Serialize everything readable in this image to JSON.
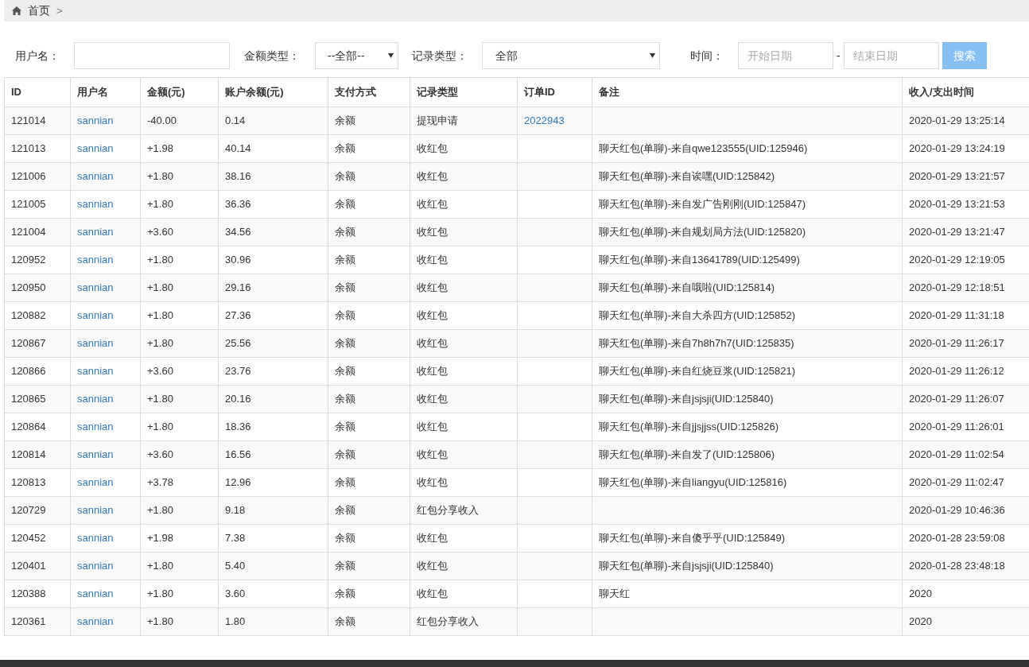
{
  "breadcrumb": {
    "home": "首页",
    "separator": ">"
  },
  "filters": {
    "username_label": "用户名：",
    "amount_type_label": "金额类型：",
    "amount_type_value": "--全部--",
    "record_type_label": "记录类型：",
    "record_type_value": "全部",
    "time_label": "时间：",
    "start_placeholder": "开始日期",
    "range_separator": "-",
    "end_placeholder": "结束日期",
    "search_button": "搜索"
  },
  "table": {
    "columns": [
      "ID",
      "用户名",
      "金额(元)",
      "账户余额(元)",
      "支付方式",
      "记录类型",
      "订单ID",
      "备注",
      "收入/支出时间"
    ],
    "rows": [
      [
        "121014",
        "sannian",
        "-40.00",
        "0.14",
        "余额",
        "提现申请",
        "2022943",
        "",
        "2020-01-29 13:25:14"
      ],
      [
        "121013",
        "sannian",
        "+1.98",
        "40.14",
        "余额",
        "收红包",
        "",
        "聊天红包(单聊)-来自qwe123555(UID:125946)",
        "2020-01-29 13:24:19"
      ],
      [
        "121006",
        "sannian",
        "+1.80",
        "38.16",
        "余额",
        "收红包",
        "",
        "聊天红包(单聊)-来自诶嘿(UID:125842)",
        "2020-01-29 13:21:57"
      ],
      [
        "121005",
        "sannian",
        "+1.80",
        "36.36",
        "余额",
        "收红包",
        "",
        "聊天红包(单聊)-来自发广告刚刚(UID:125847)",
        "2020-01-29 13:21:53"
      ],
      [
        "121004",
        "sannian",
        "+3.60",
        "34.56",
        "余额",
        "收红包",
        "",
        "聊天红包(单聊)-来自规划局方法(UID:125820)",
        "2020-01-29 13:21:47"
      ],
      [
        "120952",
        "sannian",
        "+1.80",
        "30.96",
        "余额",
        "收红包",
        "",
        "聊天红包(单聊)-来自13641789(UID:125499)",
        "2020-01-29 12:19:05"
      ],
      [
        "120950",
        "sannian",
        "+1.80",
        "29.16",
        "余额",
        "收红包",
        "",
        "聊天红包(单聊)-来自哦啦(UID:125814)",
        "2020-01-29 12:18:51"
      ],
      [
        "120882",
        "sannian",
        "+1.80",
        "27.36",
        "余额",
        "收红包",
        "",
        "聊天红包(单聊)-来自大杀四方(UID:125852)",
        "2020-01-29 11:31:18"
      ],
      [
        "120867",
        "sannian",
        "+1.80",
        "25.56",
        "余额",
        "收红包",
        "",
        "聊天红包(单聊)-来自7h8h7h7(UID:125835)",
        "2020-01-29 11:26:17"
      ],
      [
        "120866",
        "sannian",
        "+3.60",
        "23.76",
        "余额",
        "收红包",
        "",
        "聊天红包(单聊)-来自红烧豆浆(UID:125821)",
        "2020-01-29 11:26:12"
      ],
      [
        "120865",
        "sannian",
        "+1.80",
        "20.16",
        "余额",
        "收红包",
        "",
        "聊天红包(单聊)-来自jsjsji(UID:125840)",
        "2020-01-29 11:26:07"
      ],
      [
        "120864",
        "sannian",
        "+1.80",
        "18.36",
        "余额",
        "收红包",
        "",
        "聊天红包(单聊)-来自jjsjjss(UID:125826)",
        "2020-01-29 11:26:01"
      ],
      [
        "120814",
        "sannian",
        "+3.60",
        "16.56",
        "余额",
        "收红包",
        "",
        "聊天红包(单聊)-来自发了(UID:125806)",
        "2020-01-29 11:02:54"
      ],
      [
        "120813",
        "sannian",
        "+3.78",
        "12.96",
        "余额",
        "收红包",
        "",
        "聊天红包(单聊)-来自liangyu(UID:125816)",
        "2020-01-29 11:02:47"
      ],
      [
        "120729",
        "sannian",
        "+1.80",
        "9.18",
        "余额",
        "红包分享收入",
        "",
        "",
        "2020-01-29 10:46:36"
      ],
      [
        "120452",
        "sannian",
        "+1.98",
        "7.38",
        "余额",
        "收红包",
        "",
        "聊天红包(单聊)-来自傻乎乎(UID:125849)",
        "2020-01-28 23:59:08"
      ],
      [
        "120401",
        "sannian",
        "+1.80",
        "5.40",
        "余额",
        "收红包",
        "",
        "聊天红包(单聊)-来自jsjsji(UID:125840)",
        "2020-01-28 23:48:18"
      ],
      [
        "120388",
        "sannian",
        "+1.80",
        "3.60",
        "余额",
        "收红包",
        "",
        "聊天红",
        "2020"
      ],
      [
        "120361",
        "sannian",
        "+1.80",
        "1.80",
        "余额",
        "红包分享收入",
        "",
        "",
        "2020"
      ]
    ]
  }
}
